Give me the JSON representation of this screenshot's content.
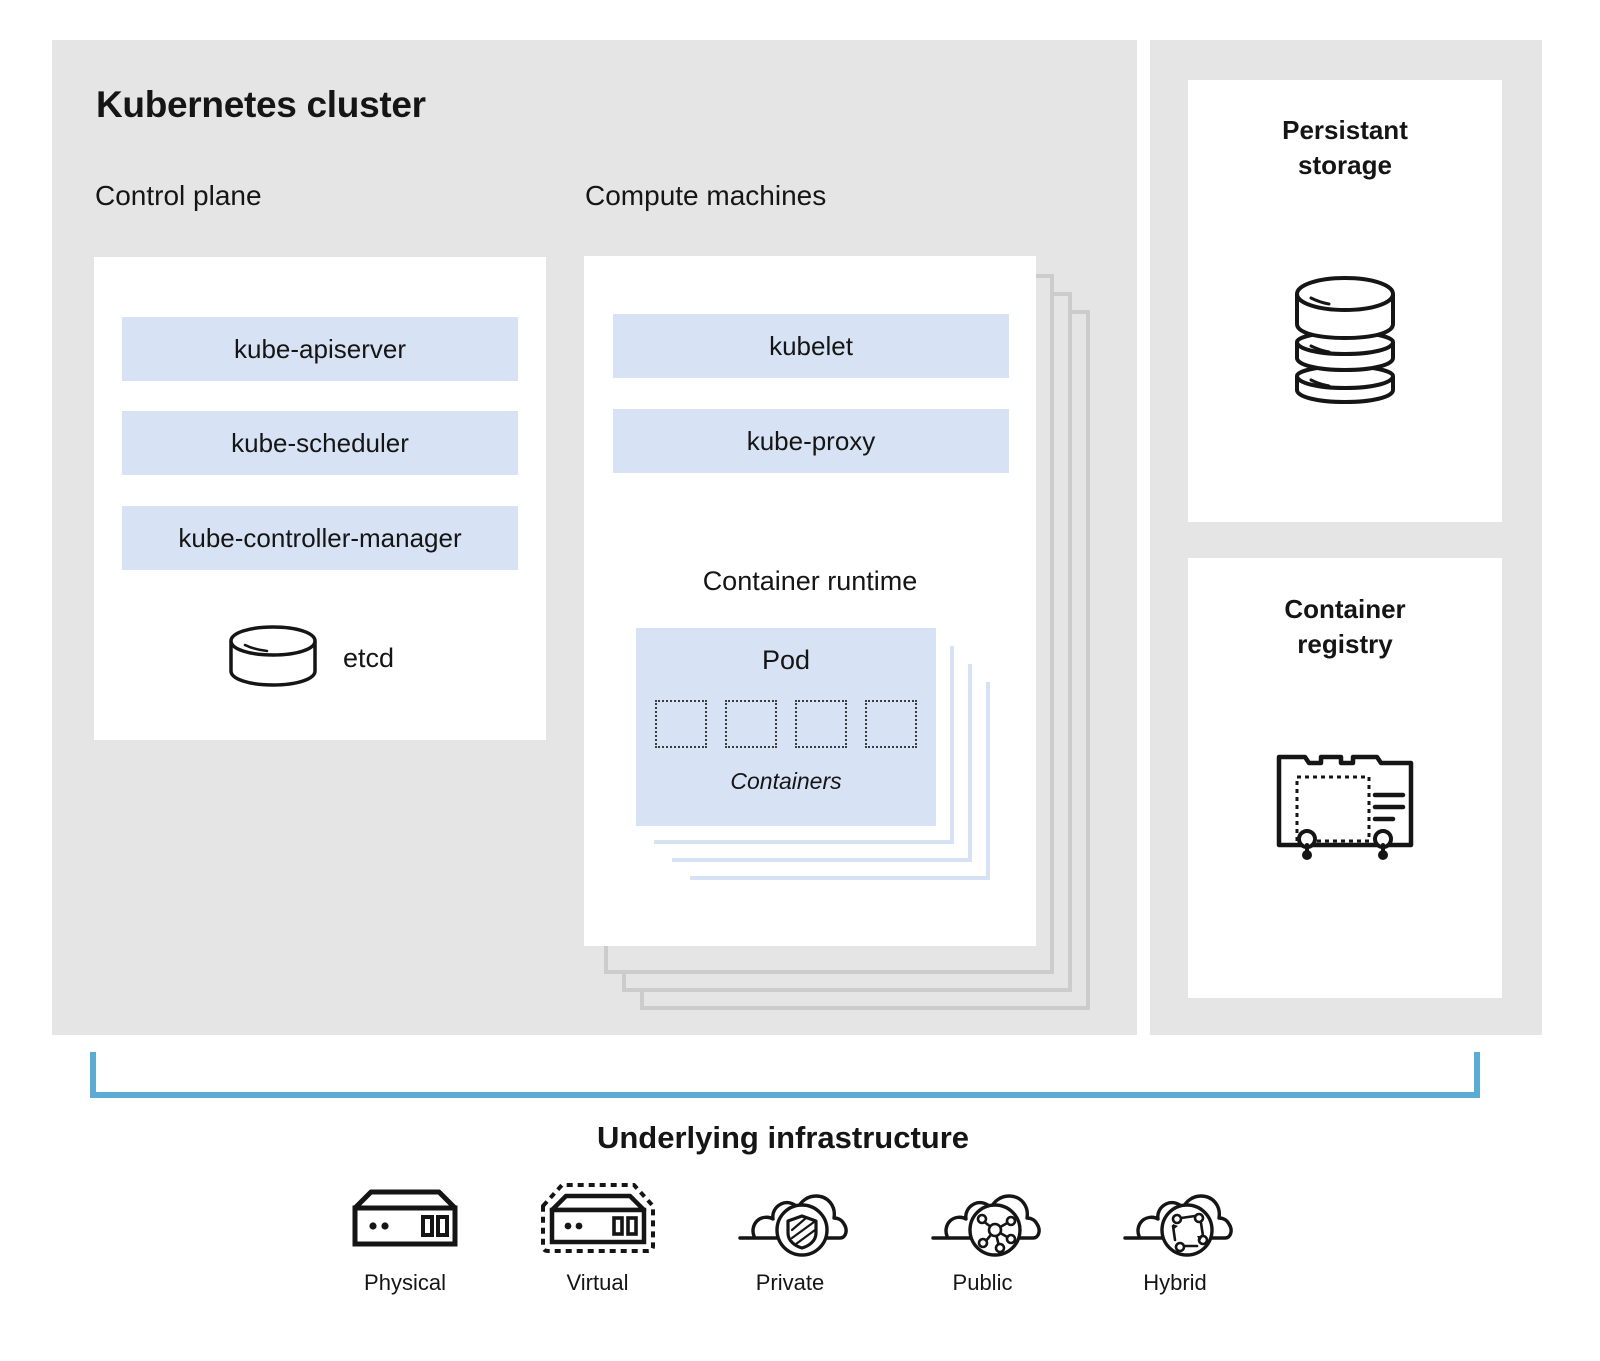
{
  "cluster": {
    "title": "Kubernetes cluster",
    "control_plane": {
      "title": "Control plane",
      "components": [
        "kube-apiserver",
        "kube-scheduler",
        "kube-controller-manager"
      ],
      "datastore": {
        "label": "etcd",
        "icon": "database-cylinder-icon"
      }
    },
    "compute_machines": {
      "title": "Compute machines",
      "components": [
        "kubelet",
        "kube-proxy"
      ],
      "runtime_title": "Container runtime",
      "pod": {
        "label": "Pod",
        "containers_label": "Containers",
        "container_count": 4,
        "stack_count": 3
      },
      "machine_stack_count": 3
    }
  },
  "side_panel": {
    "storage": {
      "title_line1": "Persistant",
      "title_line2": "storage",
      "icon": "database-stack-icon"
    },
    "registry": {
      "title_line1": "Container",
      "title_line2": "registry",
      "icon": "registry-case-icon"
    }
  },
  "infrastructure": {
    "title": "Underlying infrastructure",
    "items": [
      {
        "label": "Physical",
        "icon": "server-icon"
      },
      {
        "label": "Virtual",
        "icon": "server-dashed-icon"
      },
      {
        "label": "Private",
        "icon": "cloud-shield-icon"
      },
      {
        "label": "Public",
        "icon": "cloud-network-icon"
      },
      {
        "label": "Hybrid",
        "icon": "cloud-cycle-icon"
      }
    ]
  },
  "colors": {
    "panel_gray": "#e5e5e5",
    "card_white": "#ffffff",
    "component_blue": "#d7e3f4",
    "stack_gray": "#cccccc",
    "bracket_blue": "#5bacd4",
    "text": "#151515"
  }
}
